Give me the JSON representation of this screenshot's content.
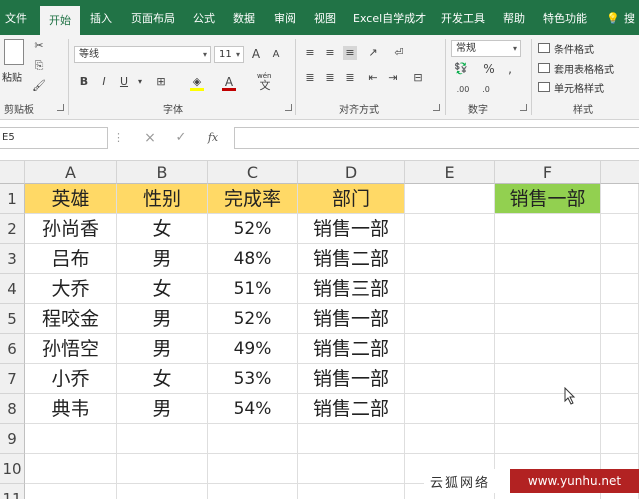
{
  "ribbon_tabs": [
    "文件",
    "开始",
    "插入",
    "页面布局",
    "公式",
    "数据",
    "审阅",
    "视图",
    "Excel自学成才",
    "开发工具",
    "帮助",
    "特色功能",
    "搜"
  ],
  "active_tab": "开始",
  "clipboard": {
    "paste_label": "粘贴",
    "group_label": "剪贴板"
  },
  "font": {
    "name": "等线",
    "size": "11",
    "bold": "B",
    "italic": "I",
    "underline": "U",
    "grow": "A",
    "shrink": "A",
    "group_label": "字体",
    "phonetic": "wén"
  },
  "alignment": {
    "group_label": "对齐方式"
  },
  "number": {
    "format": "常规",
    "percent": "%",
    "comma": ",",
    "group_label": "数字"
  },
  "styles": {
    "conditional": "条件格式",
    "table": "套用表格格式",
    "cell": "单元格样式",
    "group_label": "样式"
  },
  "formula_bar": {
    "name_box": "E5",
    "cancel": "×",
    "enter": "✓",
    "fx": "fx",
    "value": ""
  },
  "columns": [
    "A",
    "B",
    "C",
    "D",
    "E",
    "F"
  ],
  "rows": [
    "1",
    "2",
    "3",
    "4",
    "5",
    "6",
    "7",
    "8",
    "9",
    "10",
    "11"
  ],
  "table": {
    "headers": [
      "英雄",
      "性别",
      "完成率",
      "部门"
    ],
    "data": [
      [
        "孙尚香",
        "女",
        "52%",
        "销售一部"
      ],
      [
        "吕布",
        "男",
        "48%",
        "销售二部"
      ],
      [
        "大乔",
        "女",
        "51%",
        "销售三部"
      ],
      [
        "程咬金",
        "男",
        "52%",
        "销售一部"
      ],
      [
        "孙悟空",
        "男",
        "49%",
        "销售二部"
      ],
      [
        "小乔",
        "女",
        "53%",
        "销售一部"
      ],
      [
        "典韦",
        "男",
        "54%",
        "销售二部"
      ]
    ]
  },
  "f1_value": "销售一部",
  "watermark": {
    "text": "云狐网络",
    "site": "www.yunhu.net"
  },
  "colors": {
    "header_fill": "#ffd966",
    "f1_fill": "#92d050",
    "ribbon_green": "#217346"
  }
}
